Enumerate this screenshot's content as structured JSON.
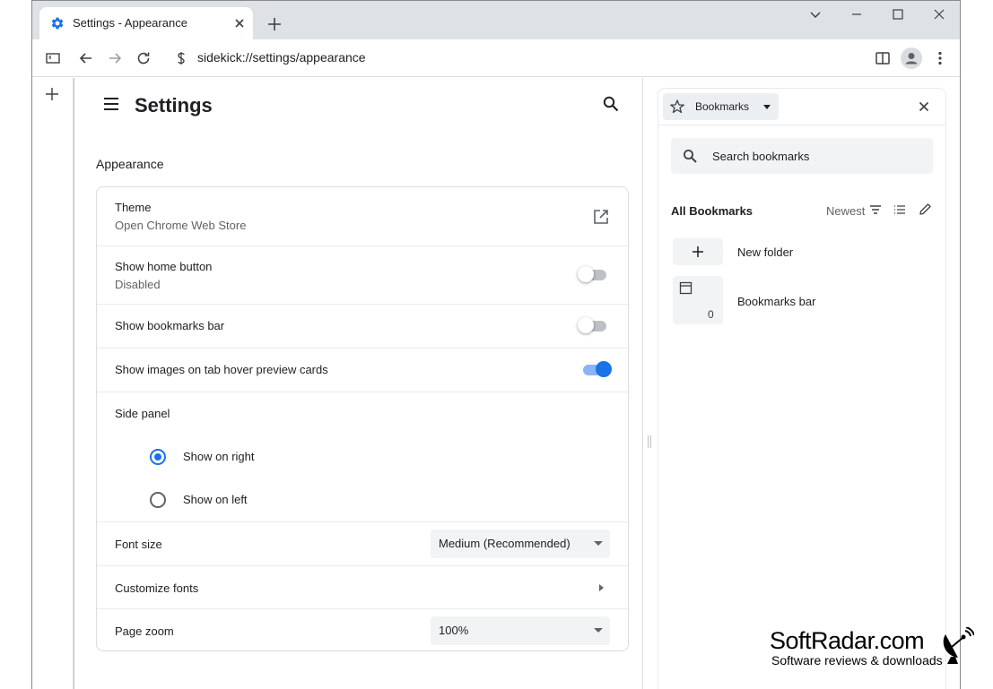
{
  "tab": {
    "title": "Settings - Appearance"
  },
  "toolbar": {
    "url": "sidekick://settings/appearance"
  },
  "settings": {
    "header_title": "Settings",
    "section_title": "Appearance",
    "theme": {
      "label": "Theme",
      "sub": "Open Chrome Web Store"
    },
    "home_button": {
      "label": "Show home button",
      "sub": "Disabled",
      "enabled": false
    },
    "bookmarks_bar": {
      "label": "Show bookmarks bar",
      "enabled": false
    },
    "tab_hover": {
      "label": "Show images on tab hover preview cards",
      "enabled": true
    },
    "side_panel": {
      "label": "Side panel",
      "options": [
        "Show on right",
        "Show on left"
      ],
      "selected": "Show on right"
    },
    "font_size": {
      "label": "Font size",
      "value": "Medium (Recommended)"
    },
    "customize_fonts": {
      "label": "Customize fonts"
    },
    "page_zoom": {
      "label": "Page zoom",
      "value": "100%"
    }
  },
  "side_panel_bookmarks": {
    "dropdown_label": "Bookmarks",
    "search_placeholder": "Search bookmarks",
    "heading": "All Bookmarks",
    "sort_label": "Newest",
    "items": [
      {
        "label": "New folder"
      },
      {
        "label": "Bookmarks bar",
        "count": "0"
      }
    ]
  },
  "watermark": {
    "brand": "SoftRadar.com",
    "tagline": "Software reviews & downloads"
  },
  "colors": {
    "accent": "#1a73e8",
    "tabstrip": "#dee1e6"
  }
}
